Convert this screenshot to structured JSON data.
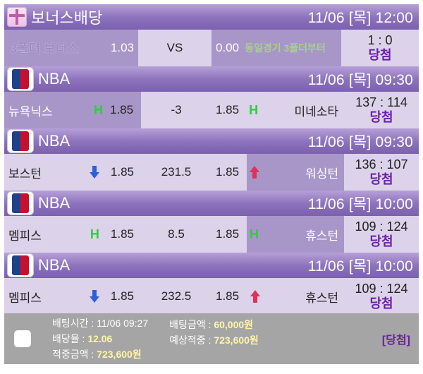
{
  "bonus": {
    "header_title": "보너스배당",
    "datetime": "11/06 [목] 12:00",
    "name": "3폴더 보너스",
    "odd_home": "1.03",
    "mid": "VS",
    "odd_away": "0.00",
    "desc": "동일경기 3폴더부터",
    "score": "1 : 0",
    "result": "당첨"
  },
  "games": [
    {
      "league": "NBA",
      "datetime": "11/06 [목] 09:30",
      "home": "뉴욕닉스",
      "home_ind": "H",
      "odd_home": "1.85",
      "mid": "-3",
      "odd_away": "1.85",
      "away_ind": "H",
      "away": "미네소타",
      "score": "137 : 114",
      "result": "당첨"
    },
    {
      "league": "NBA",
      "datetime": "11/06 [목] 09:30",
      "home": "보스턴",
      "home_ind": "down-arrow",
      "odd_home": "1.85",
      "mid": "231.5",
      "odd_away": "1.85",
      "away_ind": "up-arrow",
      "away": "워싱턴",
      "score": "136 : 107",
      "result": "당첨"
    },
    {
      "league": "NBA",
      "datetime": "11/06 [목] 10:00",
      "home": "멤피스",
      "home_ind": "H",
      "odd_home": "1.85",
      "mid": "8.5",
      "odd_away": "1.85",
      "away_ind": "H",
      "away": "휴스턴",
      "score": "109 : 124",
      "result": "당첨"
    },
    {
      "league": "NBA",
      "datetime": "11/06 [목] 10:00",
      "home": "멤피스",
      "home_ind": "down-arrow",
      "odd_home": "1.85",
      "mid": "232.5",
      "odd_away": "1.85",
      "away_ind": "up-arrow",
      "away": "휴스턴",
      "score": "109 : 124",
      "result": "당첨"
    }
  ],
  "footer": {
    "bet_time_label": "배팅시간 : ",
    "bet_time": "11/06 09:27",
    "odds_label": "배당율 : ",
    "odds": "12.06",
    "hit_label": "적중금액 : ",
    "hit": "723,600원",
    "bet_amount_label": "배팅금액 : ",
    "bet_amount": "60,000원",
    "expected_label": "예상적중 : ",
    "expected": "723,600원",
    "status": "[당첨]"
  },
  "colors": {
    "header_gradient": "#8e74bd",
    "light_cell": "#dcd2ea",
    "mid_cell": "#a896c9",
    "win": "#6a1fa5",
    "h_indicator": "#2ecc40",
    "down_arrow": "#2f5fd6",
    "up_arrow": "#e0315a"
  }
}
